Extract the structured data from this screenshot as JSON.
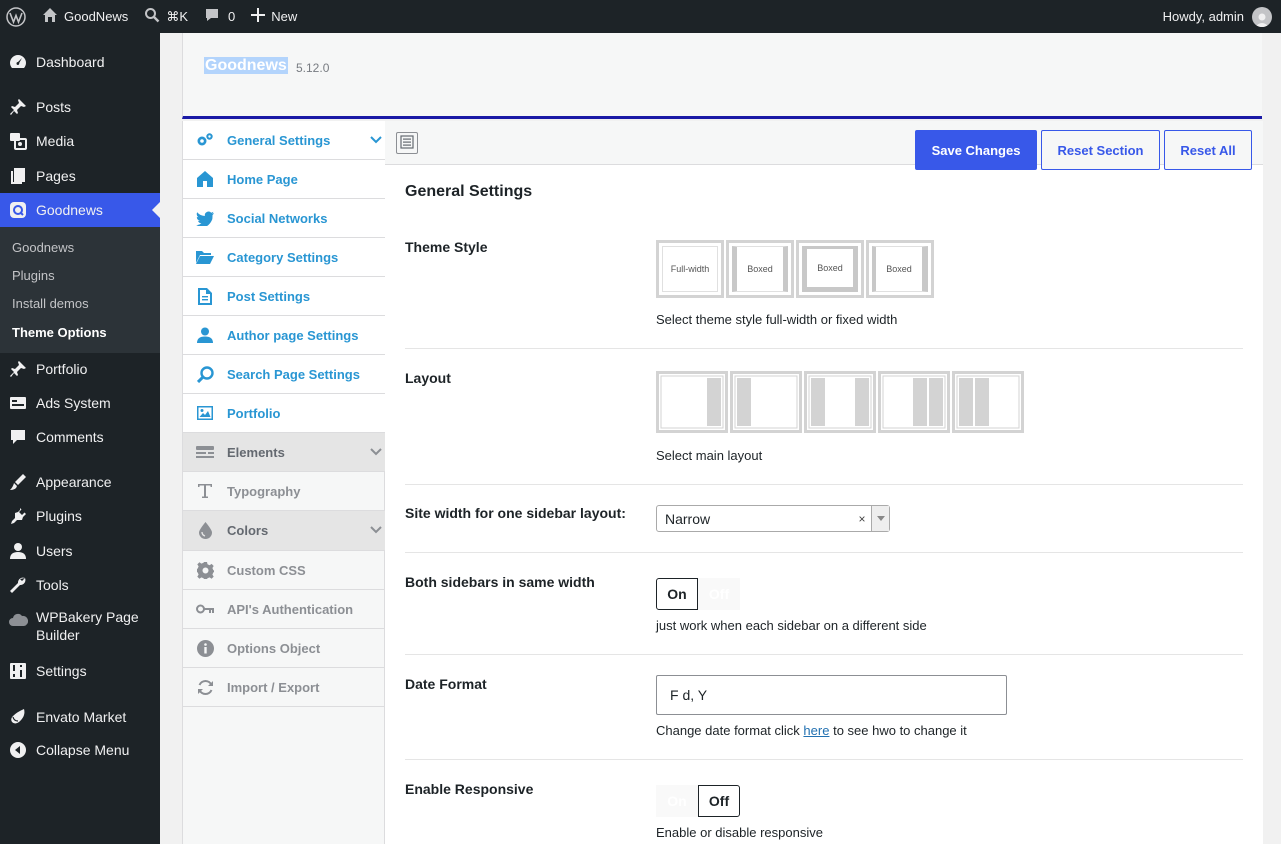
{
  "adminbar": {
    "site_name": "GoodNews",
    "search_shortcut": "⌘K",
    "comments_count": "0",
    "new_label": "New",
    "howdy": "Howdy, admin"
  },
  "menu": {
    "dashboard": "Dashboard",
    "posts": "Posts",
    "media": "Media",
    "pages": "Pages",
    "goodnews": "Goodnews",
    "submenu": {
      "goodnews": "Goodnews",
      "plugins": "Plugins",
      "install_demos": "Install demos",
      "theme_options": "Theme Options"
    },
    "portfolio": "Portfolio",
    "ads_system": "Ads System",
    "comments": "Comments",
    "appearance": "Appearance",
    "plugins": "Plugins",
    "users": "Users",
    "tools": "Tools",
    "wpbakery": "WPBakery Page Builder",
    "settings": "Settings",
    "envato": "Envato Market",
    "collapse": "Collapse Menu"
  },
  "header": {
    "title": "Goodnews",
    "version": "5.12.0"
  },
  "nav": {
    "general": "General Settings",
    "home": "Home Page",
    "social": "Social Networks",
    "category": "Category Settings",
    "post": "Post Settings",
    "author": "Author page Settings",
    "search": "Search Page Settings",
    "portfolio": "Portfolio",
    "elements": "Elements",
    "typography": "Typography",
    "colors": "Colors",
    "custom_css": "Custom CSS",
    "api": "API's Authentication",
    "options_object": "Options Object",
    "import_export": "Import / Export"
  },
  "toolbar": {
    "save": "Save Changes",
    "reset_section": "Reset Section",
    "reset_all": "Reset All"
  },
  "section": {
    "title": "General Settings",
    "theme_style": {
      "label": "Theme Style",
      "options": [
        "Full-width",
        "Boxed",
        "Boxed",
        "Boxed"
      ],
      "desc": "Select theme style full-width or fixed width"
    },
    "layout": {
      "label": "Layout",
      "desc": "Select main layout"
    },
    "site_width": {
      "label": "Site width for one sidebar layout:",
      "value": "Narrow",
      "clear": "×"
    },
    "both_sidebars": {
      "label": "Both sidebars in same width",
      "on": "On",
      "off": "Off",
      "desc": "just work when each sidebar on a different side"
    },
    "date_format": {
      "label": "Date Format",
      "value": "F d, Y",
      "desc_before": "Change date format click",
      "link": "here",
      "desc_after": "to see hwo to change it"
    },
    "responsive": {
      "label": "Enable Responsive",
      "on": "On",
      "off": "Off",
      "desc": "Enable or disable responsive"
    }
  },
  "colors": {
    "accent": "#3858e9",
    "nav_blue": "#2996d3",
    "admin_dark": "#1d2327"
  }
}
